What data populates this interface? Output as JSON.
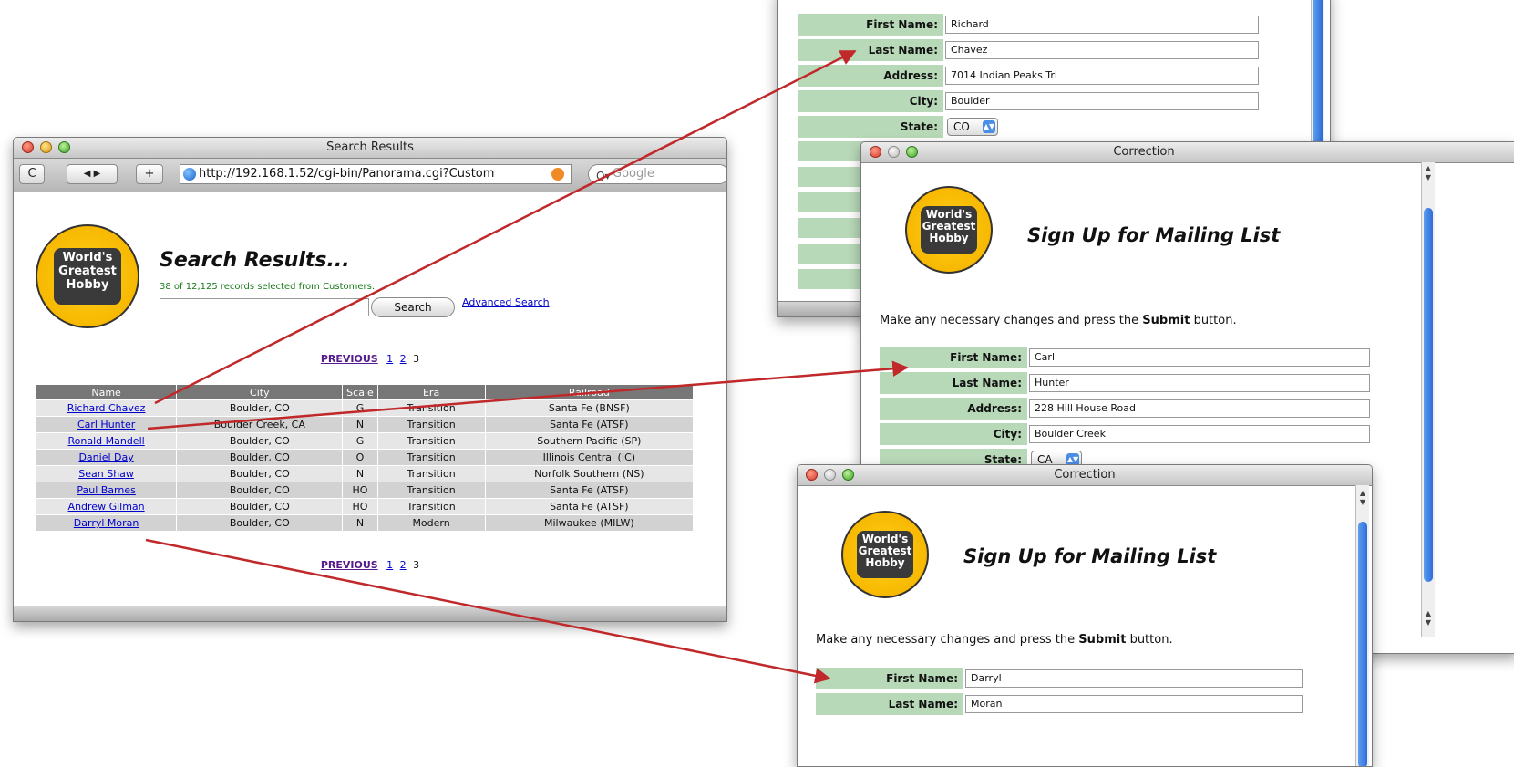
{
  "search_window": {
    "title": "Search Results",
    "toolbar": {
      "reload": "C",
      "back_forward": "◀ ▶",
      "add": "+",
      "url": "http://192.168.1.52/cgi-bin/Panorama.cgi?Custom",
      "search_placeholder": "Google"
    },
    "logo": [
      "World's",
      "Greatest",
      "Hobby"
    ],
    "heading": "Search Results...",
    "count_text": "38 of 12,125 records selected from Customers.",
    "search_button": "Search",
    "advanced_link": "Advanced Search",
    "pager": {
      "previous": "PREVIOUS",
      "pages": [
        "1",
        "2",
        "3"
      ]
    },
    "table": {
      "headers": [
        "Name",
        "City",
        "Scale",
        "Era",
        "Railroad"
      ],
      "rows": [
        [
          "Richard Chavez",
          "Boulder, CO",
          "G",
          "Transition",
          "Santa Fe (BNSF)"
        ],
        [
          "Carl Hunter",
          "Boulder Creek, CA",
          "N",
          "Transition",
          "Santa Fe (ATSF)"
        ],
        [
          "Ronald Mandell",
          "Boulder, CO",
          "G",
          "Transition",
          "Southern Pacific (SP)"
        ],
        [
          "Daniel Day",
          "Boulder, CO",
          "O",
          "Transition",
          "Illinois Central (IC)"
        ],
        [
          "Sean Shaw",
          "Boulder, CO",
          "N",
          "Transition",
          "Norfolk Southern (NS)"
        ],
        [
          "Paul Barnes",
          "Boulder, CO",
          "HO",
          "Transition",
          "Santa Fe (ATSF)"
        ],
        [
          "Andrew Gilman",
          "Boulder, CO",
          "HO",
          "Transition",
          "Santa Fe (ATSF)"
        ],
        [
          "Darryl Moran",
          "Boulder, CO",
          "N",
          "Modern",
          "Milwaukee (MILW)"
        ]
      ]
    }
  },
  "back_form": {
    "labels": {
      "first": "First Name:",
      "last": "Last Name:",
      "address": "Address:",
      "city": "City:",
      "state": "State:"
    },
    "values": {
      "first": "Richard",
      "last": "Chavez",
      "address": "7014 Indian Peaks Trl",
      "city": "Boulder",
      "state": "CO"
    }
  },
  "correction_window_1": {
    "title": "Correction",
    "heading": "Sign Up for Mailing List",
    "instruction_pre": "Make any necessary changes and press the",
    "instruction_bold": "Submit",
    "instruction_post": "button.",
    "labels": {
      "first": "First Name:",
      "last": "Last Name:",
      "address": "Address:",
      "city": "City:",
      "state": "State:"
    },
    "values": {
      "first": "Carl",
      "last": "Hunter",
      "address": "228 Hill House Road",
      "city": "Boulder Creek",
      "state": "CA"
    }
  },
  "correction_window_2": {
    "title": "Correction",
    "heading": "Sign Up for Mailing List",
    "instruction_pre": "Make any necessary changes and press the",
    "instruction_bold": "Submit",
    "instruction_post": "button.",
    "labels": {
      "first": "First Name:",
      "last": "Last Name:"
    },
    "values": {
      "first": "Darryl",
      "last": "Moran"
    }
  },
  "arrow_color": "#c0282a"
}
